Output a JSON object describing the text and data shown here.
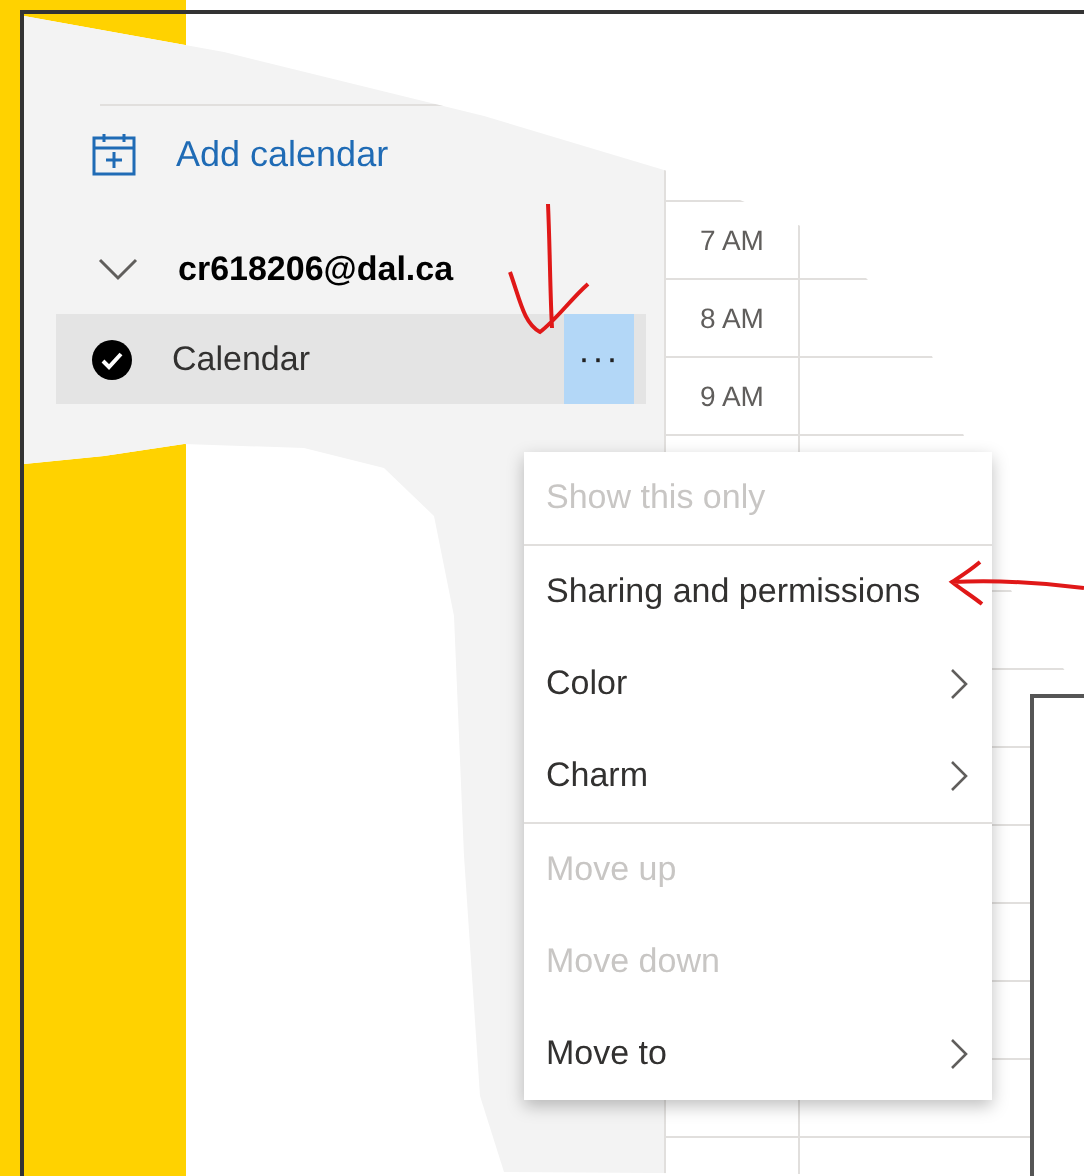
{
  "add_calendar": {
    "label": "Add calendar"
  },
  "account": {
    "name": "cr618206@dal.ca",
    "expanded": true
  },
  "calendars": [
    {
      "name": "Calendar",
      "checked": true,
      "selected": true,
      "more_label": "···"
    }
  ],
  "time_slots": [
    "7 AM",
    "8 AM",
    "9 AM"
  ],
  "context_menu": {
    "items": [
      {
        "label": "Show this only",
        "disabled": true,
        "submenu": false,
        "divider_after": true
      },
      {
        "label": "Sharing and permissions",
        "disabled": false,
        "submenu": false,
        "divider_after": false
      },
      {
        "label": "Color",
        "disabled": false,
        "submenu": true,
        "divider_after": false
      },
      {
        "label": "Charm",
        "disabled": false,
        "submenu": true,
        "divider_after": true
      },
      {
        "label": "Move up",
        "disabled": true,
        "submenu": false,
        "divider_after": false
      },
      {
        "label": "Move down",
        "disabled": true,
        "submenu": false,
        "divider_after": false
      },
      {
        "label": "Move to",
        "disabled": false,
        "submenu": true,
        "divider_after": false
      }
    ]
  },
  "annotations": [
    {
      "kind": "down-arrow"
    },
    {
      "kind": "left-arrow"
    }
  ]
}
